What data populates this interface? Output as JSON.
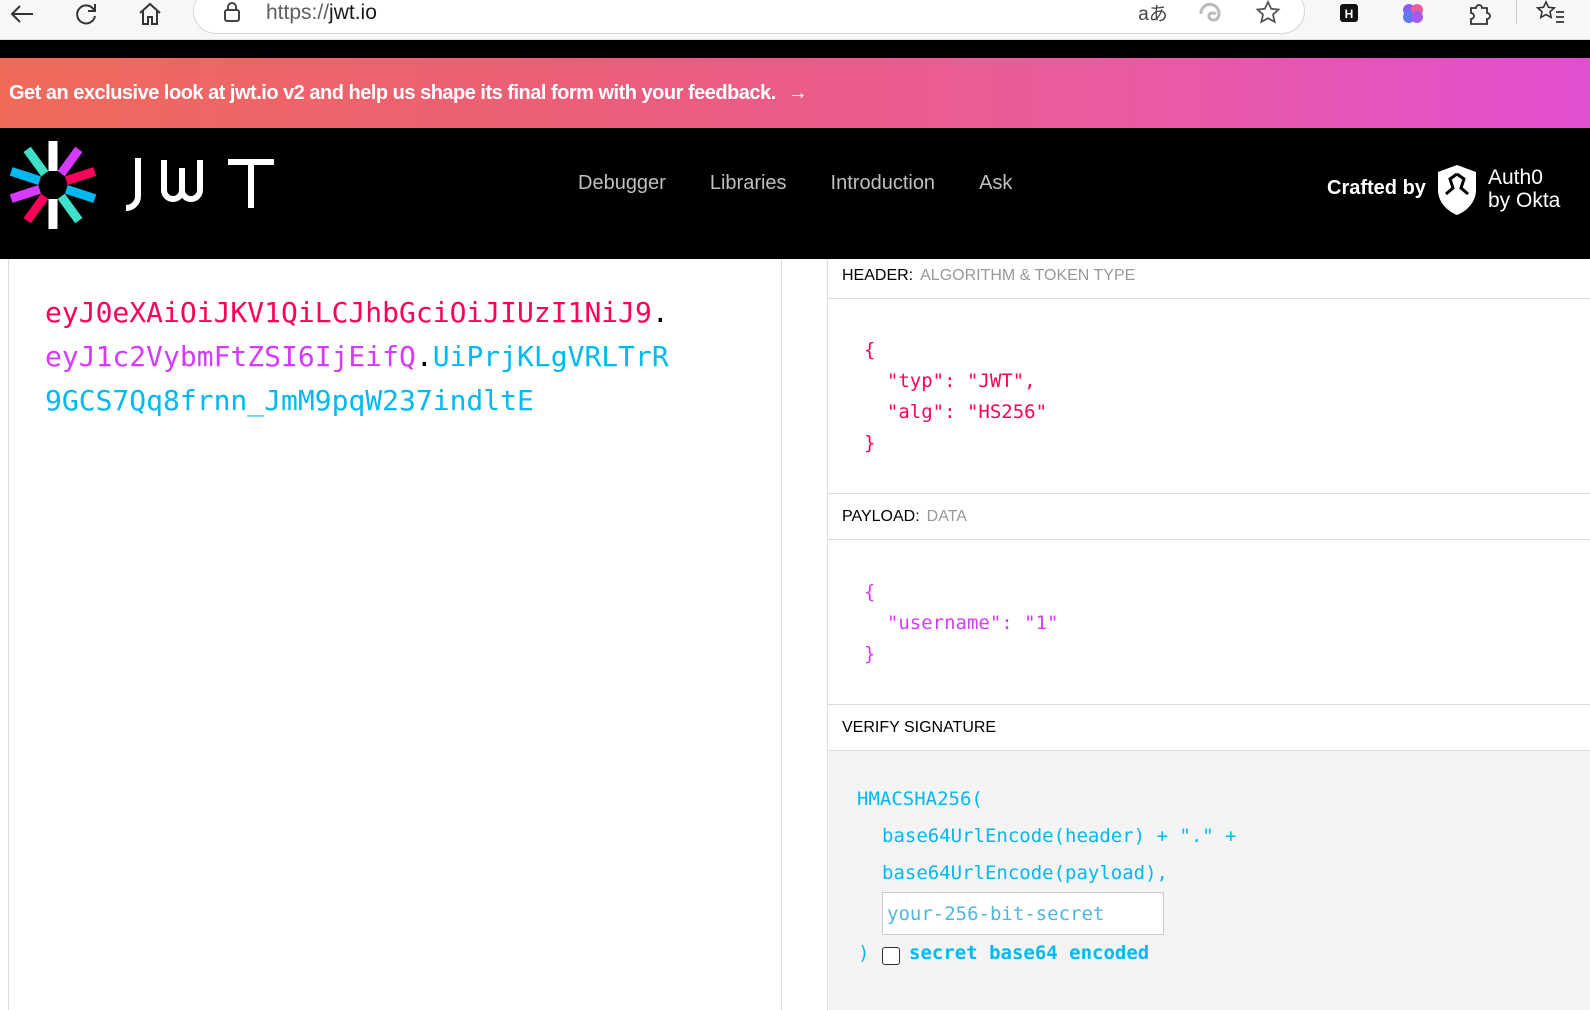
{
  "browser": {
    "url_scheme": "https://",
    "url_host": "jwt.io",
    "translate_icon": "aあ"
  },
  "banner": {
    "text": "Get an exclusive look at jwt.io v2 and help us shape its final form with your feedback.",
    "arrow": "→"
  },
  "header": {
    "nav": [
      "Debugger",
      "Libraries",
      "Introduction",
      "Ask"
    ],
    "crafted_by": "Crafted by",
    "auth0_line1": "Auth0",
    "auth0_line2": "by Okta"
  },
  "encoded": {
    "header_part": "eyJ0eXAiOiJKV1QiLCJhbGciOiJIUzI1NiJ9",
    "dot1": ".",
    "payload_part": "eyJ1c2VybmFtZSI6IjEifQ",
    "dot2": ".",
    "signature_part": "UiPrjKLgVRLTrR9GCS7Qq8frnn_JmM9pqW237indltE"
  },
  "decoded": {
    "header_title": "HEADER:",
    "header_sub": "ALGORITHM & TOKEN TYPE",
    "header_json": "{\n  \"typ\": \"JWT\",\n  \"alg\": \"HS256\"\n}",
    "payload_title": "PAYLOAD:",
    "payload_sub": "DATA",
    "payload_json": "{\n  \"username\": \"1\"\n}",
    "verify_title": "VERIFY SIGNATURE",
    "verify_line1": "HMACSHA256(",
    "verify_line2": "base64UrlEncode(header) + \".\" +",
    "verify_line3": "base64UrlEncode(payload),",
    "secret_placeholder": "your-256-bit-secret",
    "verify_close": ")",
    "b64_label": "secret base64 encoded"
  },
  "colors": {
    "header_red": "#fb015b",
    "payload_purple": "#d63aff",
    "signature_blue": "#00b9f1"
  }
}
